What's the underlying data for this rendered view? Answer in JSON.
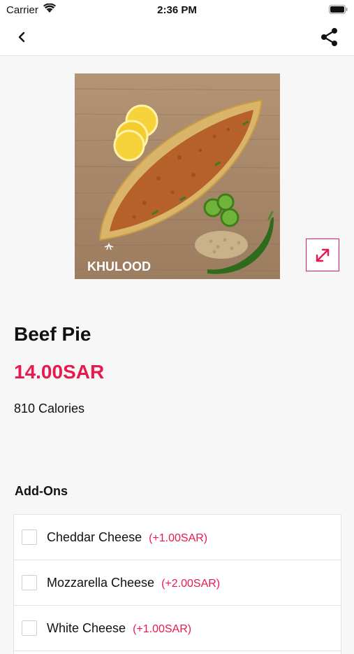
{
  "status": {
    "carrier": "Carrier",
    "time": "2:36 PM"
  },
  "nav": {
    "back_icon": "chevron-left-icon",
    "share_icon": "share-icon"
  },
  "product": {
    "title": "Beef Pie",
    "price": "14.00SAR",
    "calories": "810 Calories",
    "image_logo_text": "KHULOOD"
  },
  "addons": {
    "heading": "Add-Ons",
    "items": [
      {
        "name": "Cheddar Cheese",
        "price": "(+1.00SAR)"
      },
      {
        "name": "Mozzarella Cheese",
        "price": "(+2.00SAR)"
      },
      {
        "name": "White Cheese",
        "price": "(+1.00SAR)"
      }
    ]
  },
  "colors": {
    "accent": "#e8194f",
    "background": "#f7f7f7"
  }
}
